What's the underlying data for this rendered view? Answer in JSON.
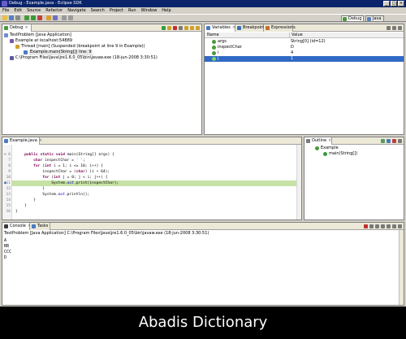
{
  "window": {
    "title": "Debug - Example.java - Eclipse SDK"
  },
  "menu": [
    "File",
    "Edit",
    "Source",
    "Refactor",
    "Navigate",
    "Search",
    "Project",
    "Run",
    "Window",
    "Help"
  ],
  "perspectives": [
    {
      "label": "Debug",
      "active": true
    },
    {
      "label": "Java",
      "active": false
    }
  ],
  "debug_view": {
    "tab": "Debug",
    "tree": [
      {
        "label": "TestProblem [Java Application]",
        "indent": 0,
        "icon": "java-app-icon"
      },
      {
        "label": "Example at localhost:54889",
        "indent": 1,
        "icon": "debug-target-icon"
      },
      {
        "label": "Thread [main] (Suspended (breakpoint at line 9 in Example))",
        "indent": 2,
        "icon": "thread-icon"
      },
      {
        "label": "Example.main(String[]) line: 9",
        "indent": 3,
        "icon": "stack-frame-icon",
        "selected": true
      },
      {
        "label": "C:\\Program Files\\Java\\jre1.6.0_05\\bin\\javaw.exe (18-jun-2008 3:30:51)",
        "indent": 1,
        "icon": "process-icon"
      }
    ]
  },
  "variables_view": {
    "tabs": [
      "Variables",
      "Breakpoints",
      "Expressions"
    ],
    "columns": [
      "Name",
      "Value"
    ],
    "rows": [
      {
        "name": "args",
        "value": "String[0]  (id=12)"
      },
      {
        "name": "inspectChar",
        "value": "D"
      },
      {
        "name": "i",
        "value": "4"
      },
      {
        "name": "j",
        "value": "1",
        "selected": true
      }
    ]
  },
  "editor": {
    "tab": "Example.java",
    "lines": [
      {
        "num": "",
        "marker": "",
        "html": ""
      },
      {
        "num": "6",
        "marker": "⊖",
        "html": "    <span class=\"kw\">public</span> <span class=\"kw\">static</span> <span class=\"kw\">void</span> main(String[] args) {"
      },
      {
        "num": "7",
        "marker": "",
        "html": "        <span class=\"kw\">char</span> inspectChar = <span class=\"st\">' '</span>;"
      },
      {
        "num": "8",
        "marker": "",
        "html": "        <span class=\"kw\">for</span> (<span class=\"kw\">int</span> i = 1; i &lt;= 10; i++) {"
      },
      {
        "num": "9",
        "marker": "",
        "html": "            inspectChar = (<span class=\"kw\">char</span>) (i + 64);"
      },
      {
        "num": "10",
        "marker": "",
        "html": "            <span class=\"kw\">for</span> (<span class=\"kw\">int</span> j = 0; j &lt; i; j++) {"
      },
      {
        "num": "11",
        "marker": "●",
        "html": "                System.<span class=\"fld\">out</span>.print(inspectChar);",
        "current": true
      },
      {
        "num": "12",
        "marker": "",
        "html": "            }"
      },
      {
        "num": "13",
        "marker": "",
        "html": "            System.<span class=\"fld\">out</span>.println();"
      },
      {
        "num": "14",
        "marker": "",
        "html": "        }"
      },
      {
        "num": "15",
        "marker": "",
        "html": "    }"
      },
      {
        "num": "16",
        "marker": "",
        "html": "}"
      }
    ]
  },
  "outline_view": {
    "tab": "Outline",
    "tree": [
      {
        "label": "Example",
        "indent": 0,
        "icon": "class-icon"
      },
      {
        "label": "main(String[])",
        "indent": 1,
        "icon": "method-icon"
      }
    ]
  },
  "console_view": {
    "tabs": [
      "Console",
      "Tasks"
    ],
    "header": "TestProblem [Java Application] C:\\Program Files\\Java\\jre1.6.0_05\\bin\\javaw.exe (18-jun-2008 3:30:51)",
    "output": [
      "A",
      "BB",
      "CCC",
      "D"
    ]
  },
  "caption": "Abadis Dictionary",
  "colors": {
    "titlebar": "#0a246a",
    "current_line": "#c6e2a6",
    "selection": "#316ac5",
    "keyword": "#7f0055"
  }
}
